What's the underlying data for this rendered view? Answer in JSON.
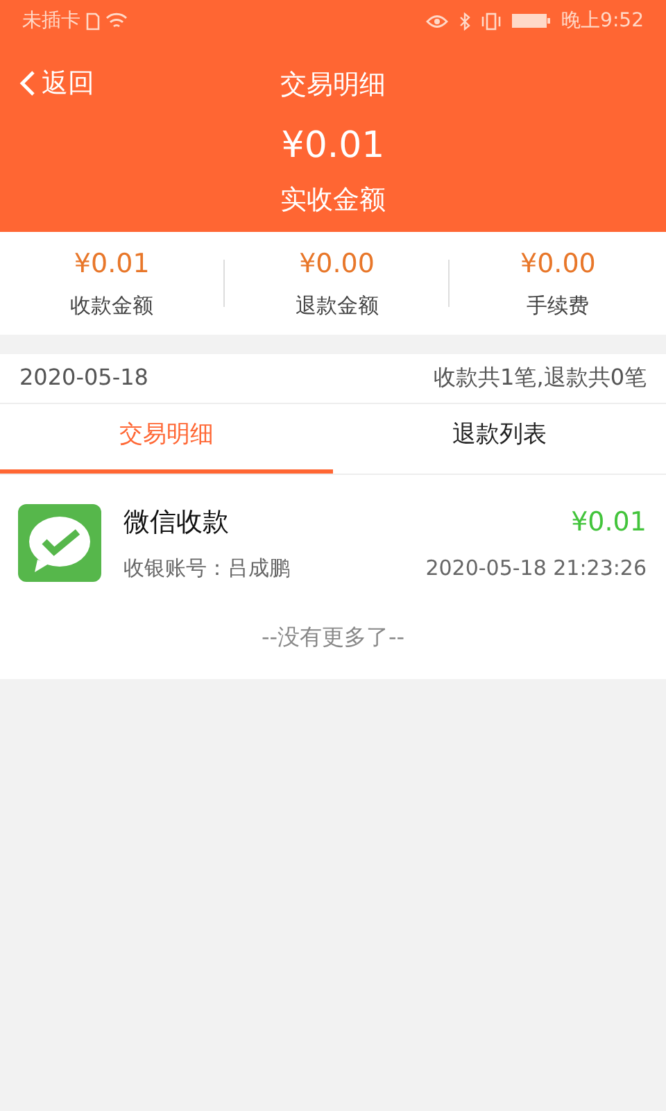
{
  "status_bar": {
    "carrier": "未插卡",
    "time": "晚上9:52"
  },
  "header": {
    "back": "返回",
    "title": "交易明细",
    "amount": "¥0.01",
    "amount_label": "实收金额"
  },
  "stats": [
    {
      "value": "¥0.01",
      "label": "收款金额"
    },
    {
      "value": "¥0.00",
      "label": "退款金额"
    },
    {
      "value": "¥0.00",
      "label": "手续费"
    }
  ],
  "summary": {
    "date": "2020-05-18",
    "counts": "收款共1笔,退款共0笔"
  },
  "tabs": [
    {
      "label": "交易明细",
      "selected": true
    },
    {
      "label": "退款列表",
      "selected": false
    }
  ],
  "transactions": [
    {
      "title": "微信收款",
      "amount": "¥0.01",
      "cashier": "收银账号：吕成鹏",
      "time": "2020-05-18 21:23:26"
    }
  ],
  "end_note": "--没有更多了--"
}
